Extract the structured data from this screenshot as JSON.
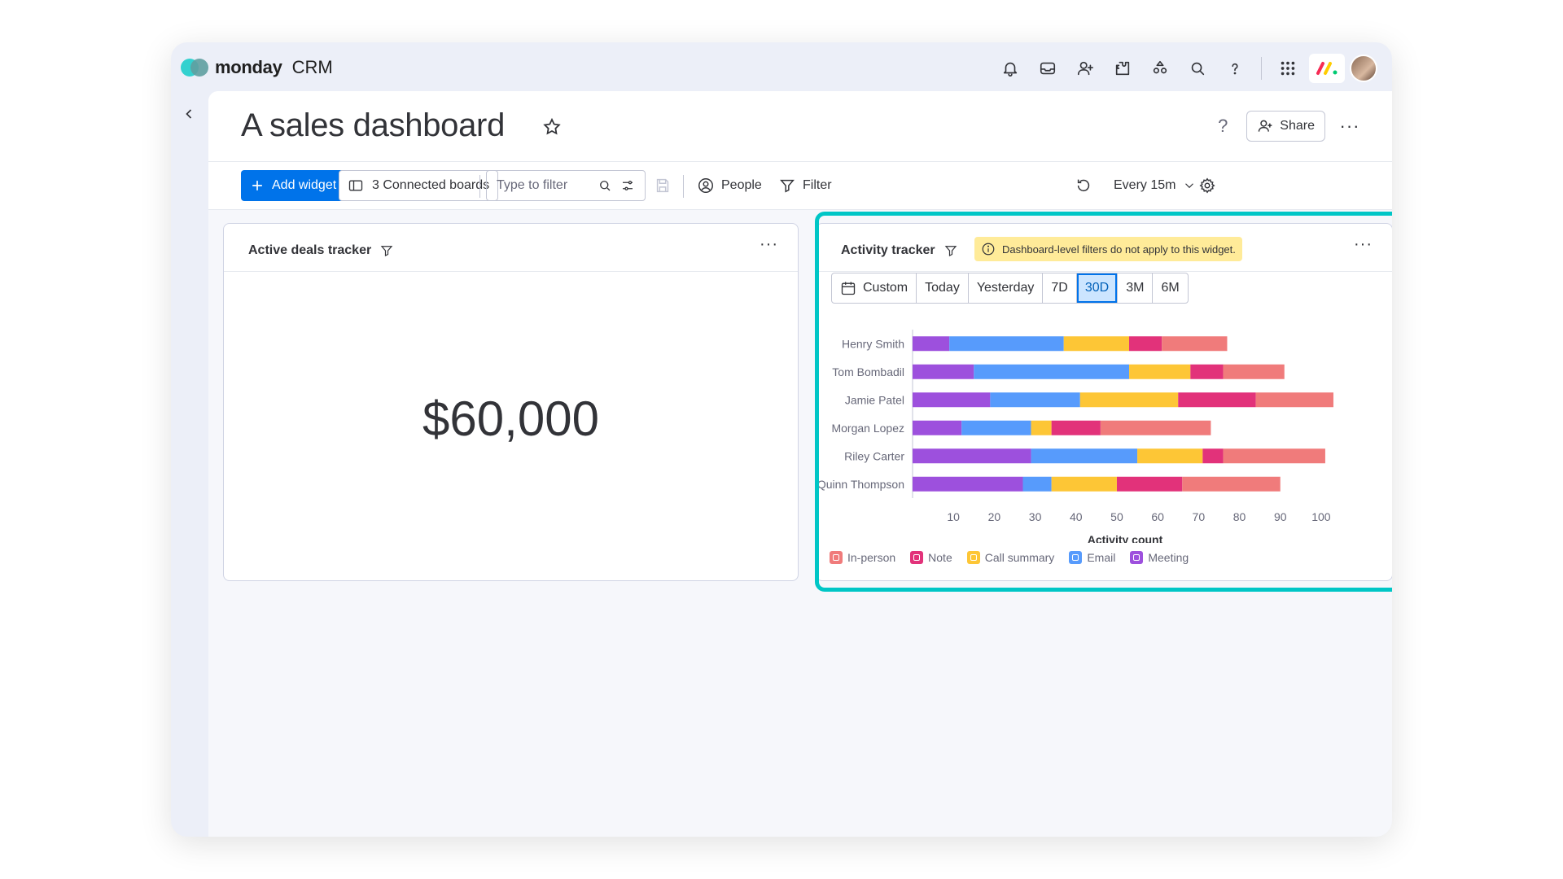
{
  "app": {
    "brand": "monday",
    "brand_suffix": "CRM",
    "top_icons": [
      "bell-icon",
      "inbox-icon",
      "invite-member-icon",
      "apps-icon",
      "marketplace-icon",
      "search-icon",
      "help-icon",
      "app-switcher-icon"
    ]
  },
  "page": {
    "title": "A sales dashboard",
    "help": "?",
    "share_label": "Share",
    "more": "···"
  },
  "toolbar": {
    "add_widget": "Add widget",
    "connected_boards": "3 Connected boards",
    "filter_placeholder": "Type to filter",
    "people": "People",
    "filter": "Filter",
    "refresh_interval": "Every 15m"
  },
  "widgets": {
    "deals": {
      "title": "Active deals tracker",
      "value": "$60,000",
      "more": "···"
    },
    "activity": {
      "title": "Activity tracker",
      "notice": "Dashboard-level filters do not apply to this widget.",
      "more": "···",
      "ranges": [
        "Custom",
        "Today",
        "Yesterday",
        "7D",
        "30D",
        "3M",
        "6M"
      ],
      "active_range": "30D"
    }
  },
  "chart_data": {
    "type": "bar",
    "orientation": "horizontal",
    "stacked": true,
    "categories": [
      "Henry Smith",
      "Tom Bombadil",
      "Jamie Patel",
      "Morgan Lopez",
      "Riley Carter",
      "Quinn Thompson"
    ],
    "series": [
      {
        "name": "Meeting",
        "color": "#9d50dd",
        "values": [
          9,
          15,
          19,
          12,
          29,
          27
        ]
      },
      {
        "name": "Email",
        "color": "#579bfc",
        "values": [
          28,
          38,
          22,
          17,
          26,
          7
        ]
      },
      {
        "name": "Call summary",
        "color": "#fdc636",
        "values": [
          16,
          15,
          24,
          5,
          16,
          16
        ]
      },
      {
        "name": "Note",
        "color": "#e2327a",
        "values": [
          8,
          8,
          19,
          12,
          5,
          16
        ]
      },
      {
        "name": "In-person",
        "color": "#f07b7b",
        "values": [
          16,
          15,
          19,
          27,
          25,
          24
        ]
      }
    ],
    "legend_order": [
      "In-person",
      "Note",
      "Call summary",
      "Email",
      "Meeting"
    ],
    "xlabel": "Activity count",
    "xticks": [
      10,
      20,
      30,
      40,
      50,
      60,
      70,
      80,
      90,
      100
    ],
    "xlim": [
      0,
      104
    ],
    "legend_position": "bottom"
  }
}
